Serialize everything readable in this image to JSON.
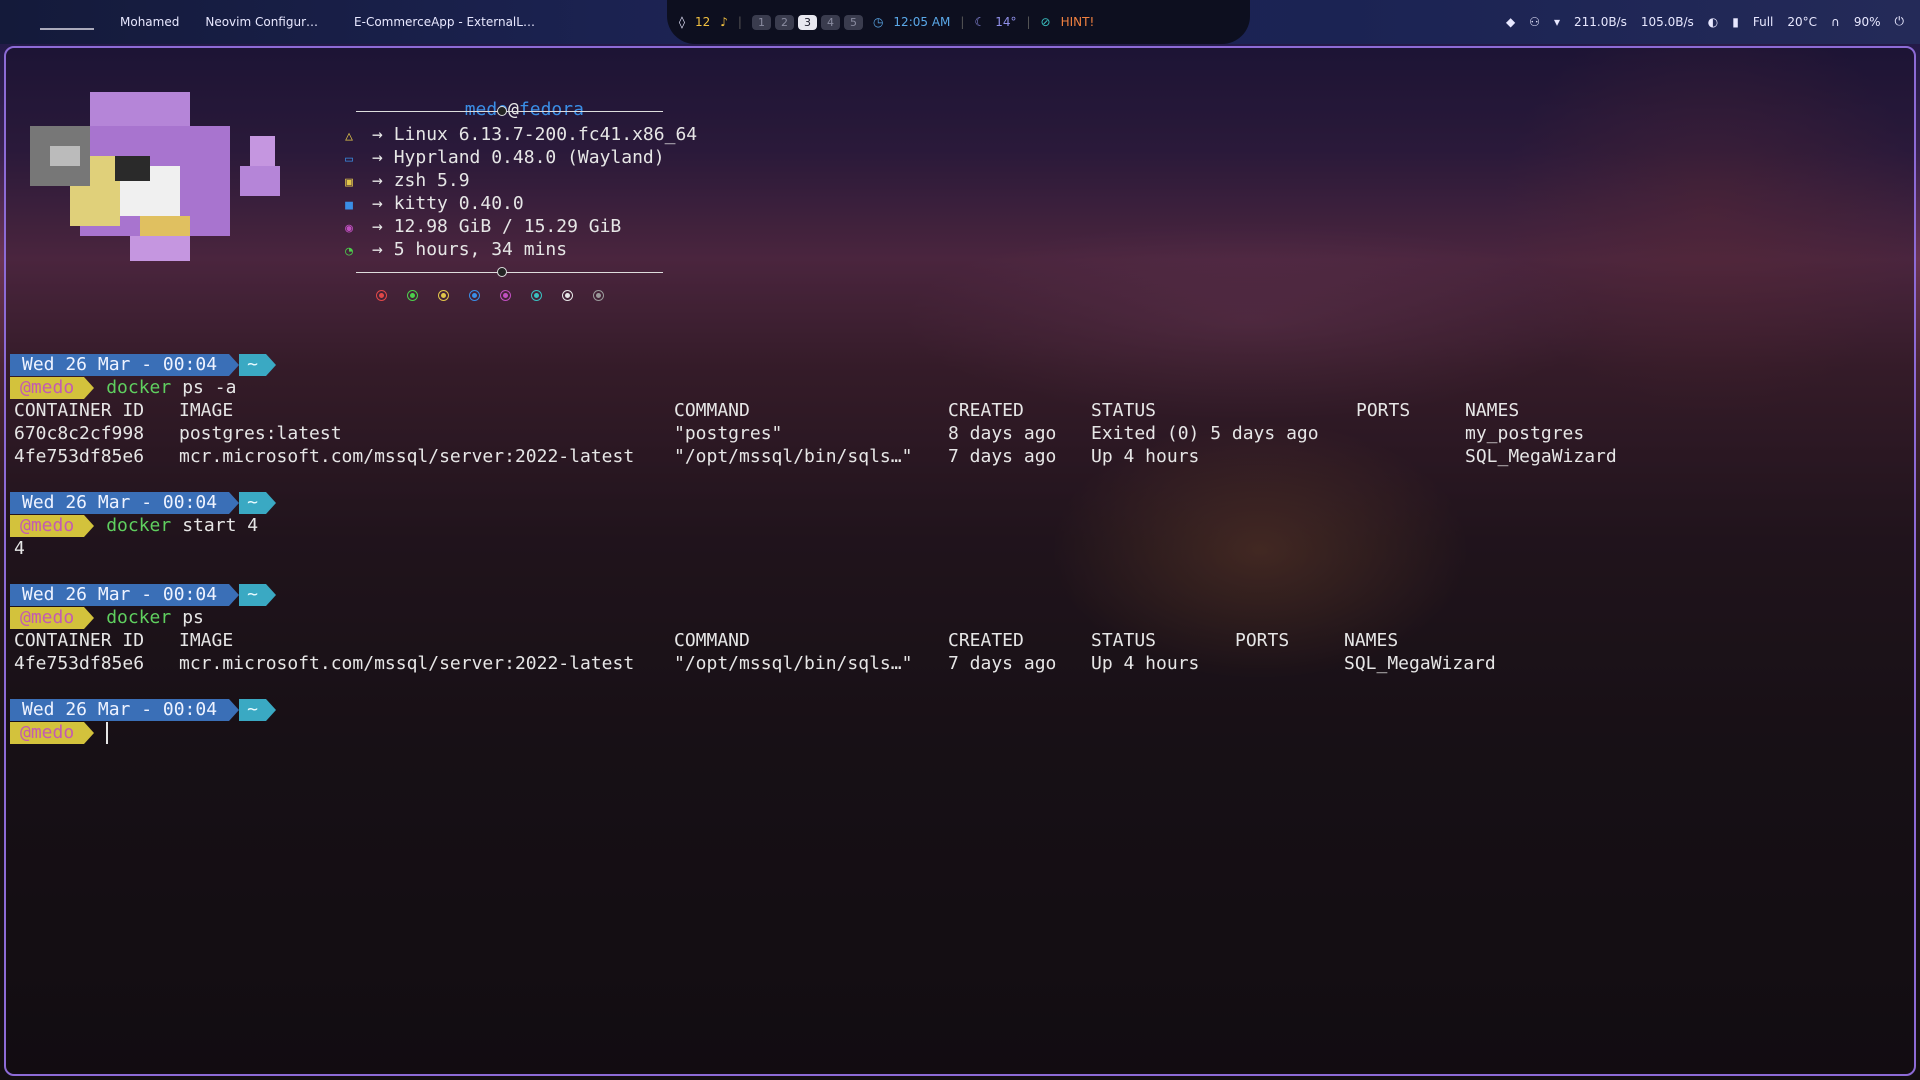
{
  "topbar": {
    "left_items": [
      "Mohamed",
      "Neovim Configur…",
      "E-CommerceApp - ExternalL…"
    ],
    "notifications": "12",
    "workspaces": [
      "1",
      "2",
      "3",
      "4",
      "5"
    ],
    "active_workspace": "3",
    "time": "12:05 AM",
    "weather": "14°",
    "hint": "HINT!",
    "download": "211.0B/s",
    "upload": "105.0B/s",
    "battery": "Full",
    "temperature": "20°C",
    "volume": "90%"
  },
  "fetch": {
    "user": "medo",
    "at": "@",
    "host": "fedora",
    "lines": [
      {
        "icon": "linux-icon",
        "text": "Linux 6.13.7-200.fc41.x86_64",
        "color": "#e2c64a"
      },
      {
        "icon": "window-icon",
        "text": "Hyprland 0.48.0 (Wayland)",
        "color": "#3a8ee6"
      },
      {
        "icon": "shell-icon",
        "text": "zsh 5.9",
        "color": "#e2c64a"
      },
      {
        "icon": "terminal-icon",
        "text": "kitty 0.40.0",
        "color": "#3a8ee6"
      },
      {
        "icon": "memory-icon",
        "text": "12.98 GiB / 15.29 GiB",
        "color": "#c050c0"
      },
      {
        "icon": "clock-icon",
        "text": "5 hours, 34 mins",
        "color": "#4ccf4c"
      }
    ],
    "palette": [
      "#e04848",
      "#4ccf4c",
      "#e2c64a",
      "#3a8ee6",
      "#c050c0",
      "#3ac0c0",
      "#e6e6e6",
      "#9a9a9a"
    ]
  },
  "prompt": {
    "date": "Wed 26 Mar - 00:04",
    "dir": "~",
    "user": "@medo"
  },
  "blocks": [
    {
      "cmd": "docker",
      "args": "ps -a"
    },
    {
      "cmd": "docker",
      "args": "start 4",
      "output": "4"
    },
    {
      "cmd": "docker",
      "args": "ps"
    },
    {
      "cmd": "",
      "args": ""
    }
  ],
  "table1": {
    "headers": [
      "CONTAINER ID",
      "IMAGE",
      "COMMAND",
      "CREATED",
      "STATUS",
      "PORTS",
      "NAMES"
    ],
    "rows": [
      [
        "670c8c2cf998",
        "postgres:latest",
        "\"postgres\"",
        "8 days ago",
        "Exited (0) 5 days ago",
        "",
        "my_postgres"
      ],
      [
        "4fe753df85e6",
        "mcr.microsoft.com/mssql/server:2022-latest",
        "\"/opt/mssql/bin/sqls…\"",
        "7 days ago",
        "Up 4 hours",
        "",
        "SQL_MegaWizard"
      ]
    ]
  },
  "table2": {
    "headers": [
      "CONTAINER ID",
      "IMAGE",
      "COMMAND",
      "CREATED",
      "STATUS",
      "PORTS",
      "NAMES"
    ],
    "rows": [
      [
        "4fe753df85e6",
        "mcr.microsoft.com/mssql/server:2022-latest",
        "\"/opt/mssql/bin/sqls…\"",
        "7 days ago",
        "Up 4 hours",
        "",
        "SQL_MegaWizard"
      ]
    ]
  }
}
